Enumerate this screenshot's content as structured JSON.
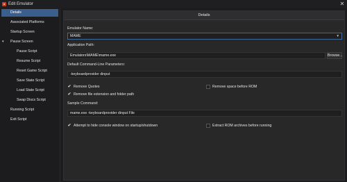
{
  "window": {
    "title": "Edit Emulator",
    "close_glyph": "✕"
  },
  "sidebar": {
    "items": [
      {
        "label": "Details",
        "selected": true,
        "indent": 0
      },
      {
        "label": "Associated Platforms",
        "indent": 0
      },
      {
        "label": "Startup Screen",
        "indent": 0
      },
      {
        "label": "Pause Screen",
        "indent": 0,
        "expanded": true
      },
      {
        "label": "Pause Script",
        "indent": 1
      },
      {
        "label": "Resume Script",
        "indent": 1
      },
      {
        "label": "Reset Game Script",
        "indent": 1
      },
      {
        "label": "Save State Script",
        "indent": 1
      },
      {
        "label": "Load State Script",
        "indent": 1
      },
      {
        "label": "Swap Discs Script",
        "indent": 1
      },
      {
        "label": "Running Script",
        "indent": 0
      },
      {
        "label": "Exit Script",
        "indent": 0
      }
    ]
  },
  "details": {
    "header": "Details",
    "emulator_name_label": "Emulator Name:",
    "emulator_name_value": "MAME",
    "app_path_label": "Application Path:",
    "app_path_value": "Emulators\\MAME\\mame.exe",
    "browse_label": "Browse...",
    "cmdline_label": "Default Command-Line Parameters:",
    "cmdline_value": "-keyboardprovider dinput",
    "remove_quotes_label": "Remove Quotes",
    "remove_quotes_checked": true,
    "remove_space_label": "Remove space before ROM",
    "remove_space_checked": false,
    "remove_ext_label": "Remove file extension and folder path",
    "remove_ext_checked": true,
    "sample_label": "Sample Command:",
    "sample_value": "mame.exe -keyboardprovider dinput File",
    "hide_console_label": "Attempt to hide console window on startup/shutdown",
    "hide_console_checked": true,
    "extract_rom_label": "Extract ROM archives before running",
    "extract_rom_checked": false
  },
  "colors": {
    "accent": "#3b5f8c",
    "background": "#1c1c1e",
    "panel": "#282829"
  }
}
